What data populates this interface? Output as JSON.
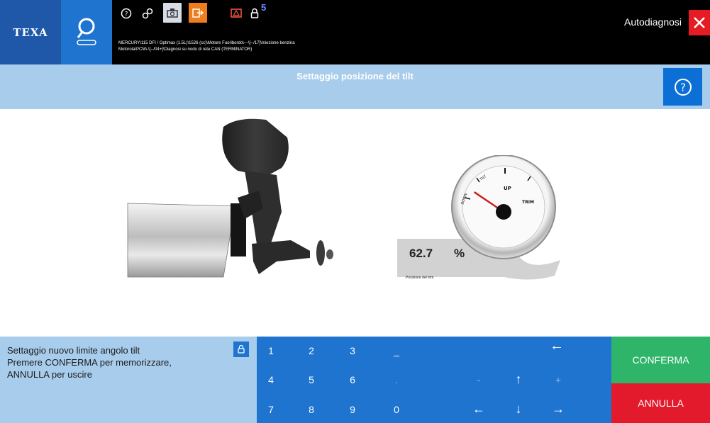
{
  "header": {
    "logo": "TEXA",
    "search_icon": "search-vehicle-icon",
    "icons": [
      "help-icon",
      "link-icon",
      "camera-icon",
      "export-icon",
      "warning-icon",
      "lock-icon"
    ],
    "lock_count": "5",
    "path_line1": "MERCURY\\115 DFI / Optimax (1.5L)\\1526 (cc)\\Motore Fuoribordo\\---\\[--/17]\\Iniezione benzina",
    "path_line2": "Motorola\\PCM\\-\\[--/04+]\\Diagnosi su nodo di rete CAN (TERMINATOR)",
    "mode": "Autodiagnosi",
    "colors": {
      "logo_bg": "#1f58a8",
      "tile_bg": "#1f74d0",
      "close_bg": "#e51c23",
      "export_bg": "#ee7d1d"
    }
  },
  "title": {
    "text": "Settaggio posizione del tilt",
    "help_icon": "help-circle-icon"
  },
  "gauge": {
    "value": "62.7",
    "unit": "%",
    "caption": "Posizione del trim",
    "face_labels": [
      "UP",
      "TRIM",
      "TILT",
      "DOWN"
    ],
    "fraction": 0.627
  },
  "message": {
    "lines": [
      "Settaggio nuovo limite angolo tilt",
      "Premere CONFERMA per memorizzare,",
      "ANNULLA per uscire"
    ],
    "lock_icon": "lock-icon"
  },
  "keypad": {
    "row1": [
      "1",
      "2",
      "3",
      "_"
    ],
    "row2": [
      "4",
      "5",
      "6",
      "."
    ],
    "row3": [
      "7",
      "8",
      "9",
      "0"
    ],
    "backspace": "←",
    "minus": "-",
    "plus": "+",
    "up": "↑",
    "down": "↓",
    "left": "←",
    "right": "→"
  },
  "actions": {
    "confirm": "CONFERMA",
    "cancel": "ANNULLA",
    "colors": {
      "confirm": "#2fb56a",
      "cancel": "#e21a2c"
    }
  }
}
